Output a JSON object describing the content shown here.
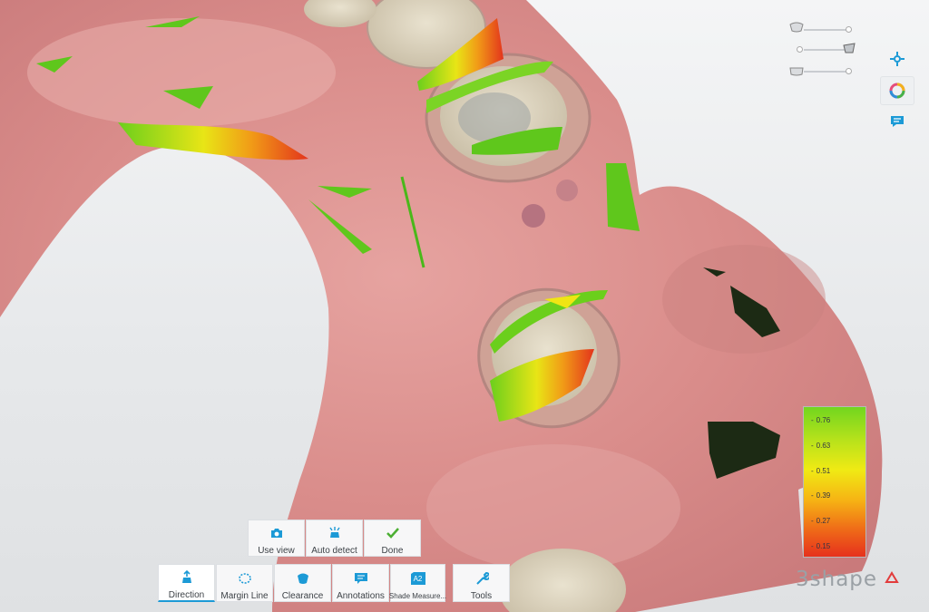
{
  "toolbar_top": {
    "use_view": "Use view",
    "auto_detect": "Auto detect",
    "done": "Done"
  },
  "toolbar_bottom": {
    "direction": "Direction",
    "margin_line": "Margin Line",
    "clearance": "Clearance",
    "annotations": "Annotations",
    "shade_measure": "Shade Measure...",
    "shade_badge": "A2",
    "tools": "Tools"
  },
  "legend": {
    "ticks": [
      "0.76",
      "0.63",
      "0.51",
      "0.39",
      "0.27",
      "0.15"
    ],
    "top_color": "#72d61f",
    "bottom_color": "#e6311d"
  },
  "brand": "3shape",
  "icons": {
    "right_panel": [
      "crosshair-move-icon",
      "color-wheel-icon",
      "annotation-message-icon"
    ],
    "sliders": [
      "upper-jaw-icon",
      "scanbody-icon",
      "lower-jaw-icon"
    ]
  },
  "colors": {
    "accent": "#1c9ad6",
    "done_check": "#4caf33",
    "tissue": "#d98c8a"
  }
}
